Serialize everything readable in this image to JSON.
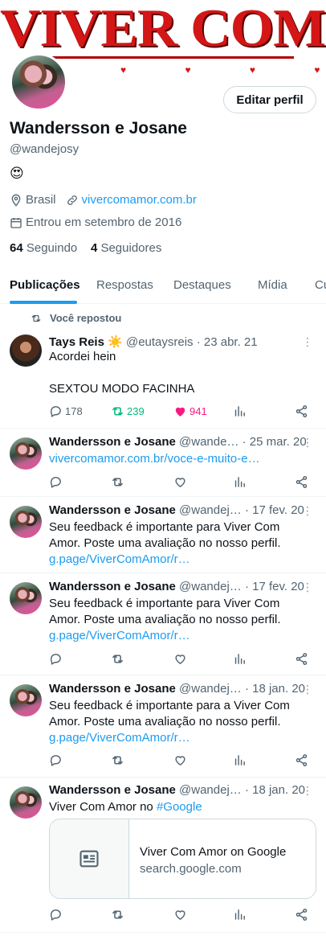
{
  "banner": {
    "text": "VIVER COM AMOR",
    "hearts": "♥ ♥ ♥ ♥ ♥"
  },
  "profile": {
    "edit_label": "Editar perfil",
    "name": "Wandersson e Josane",
    "handle": "@wandejosy",
    "bio": "😍",
    "location": "Brasil",
    "website": "vivercomamor.com.br",
    "joined": "Entrou em setembro de 2016",
    "following_count": "64",
    "following_label": "Seguindo",
    "followers_count": "4",
    "followers_label": "Seguidores"
  },
  "tabs": [
    {
      "label": "Publicações",
      "active": true
    },
    {
      "label": "Respostas"
    },
    {
      "label": "Destaques"
    },
    {
      "label": "Mídia"
    },
    {
      "label": "Cu"
    }
  ],
  "repost_note": "Você repostou",
  "tweets": [
    {
      "name": "Tays Reis",
      "badge": "☀️",
      "handle": "@eutaysreis",
      "date": "· 23 abr. 21",
      "lines": [
        "Acordei hein",
        "",
        "SEXTOU MODO FACINHA"
      ],
      "replies": "178",
      "reposts": "239",
      "likes": "941"
    },
    {
      "name": "Wandersson e Josane",
      "handle": "@wande…",
      "date": "· 25 mar. 20",
      "link": "vivercomamor.com.br/voce-e-muito-e…"
    },
    {
      "name": "Wandersson e Josane",
      "handle": "@wandej…",
      "date": "· 17 fev. 20",
      "lines": [
        "Seu feedback é importante para Viver Com",
        "Amor. Poste uma avaliação no nosso perfil."
      ],
      "link": "g.page/ViverComAmor/r…"
    },
    {
      "name": "Wandersson e Josane",
      "handle": "@wandej…",
      "date": "· 17 fev. 20",
      "lines": [
        "Seu feedback é importante para Viver Com",
        "Amor. Poste uma avaliação no nosso perfil."
      ],
      "link": "g.page/ViverComAmor/r…"
    },
    {
      "name": "Wandersson e Josane",
      "handle": "@wandej…",
      "date": "· 18 jan. 20",
      "lines": [
        "Seu feedback é importante para a Viver Com",
        "Amor. Poste uma avaliação no nosso perfil."
      ],
      "link": "g.page/ViverComAmor/r…"
    },
    {
      "name": "Wandersson e Josane",
      "handle": "@wandej…",
      "date": "· 18 jan. 20",
      "text": "Viver Com Amor no ",
      "hashtag": "#Google",
      "card_title": "Viver Com Amor on Google",
      "card_sub": "search.google.com"
    }
  ],
  "colors": {
    "accent": "#1d9bf0",
    "repost_green": "#00ba7c",
    "like_pink": "#f91880",
    "banner_red": "#d41616"
  }
}
